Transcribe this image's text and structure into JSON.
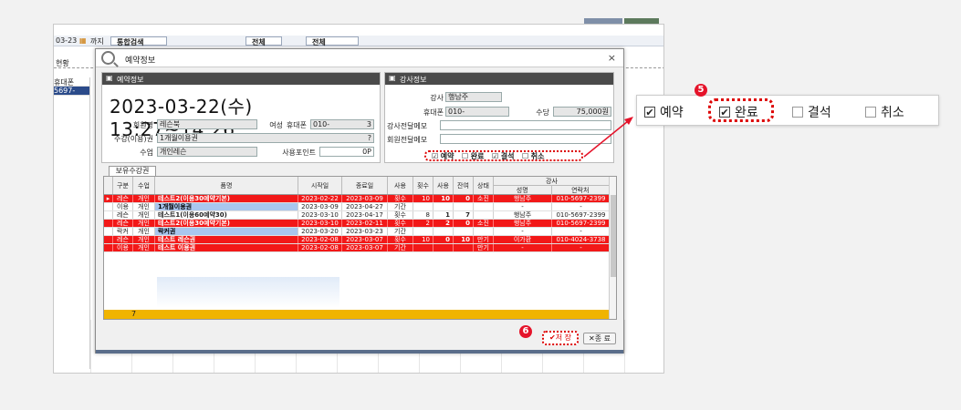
{
  "background": {
    "date": "03-23",
    "until": "까지",
    "search_type": "통합검색",
    "filter1": "전체",
    "filter2": "전체",
    "left_tab": "현황",
    "col_phone": "휴대폰",
    "phone_fragment": "5697-2399"
  },
  "dialog": {
    "title": "예약정보",
    "close": "×",
    "reservation_header": "예약정보",
    "date_time": "2023-03-22(수)  13:27~14:26",
    "member_name_label": "회원명",
    "member_name": "레슨북",
    "gender": "여성",
    "phone_label": "휴대폰",
    "phone_value": "010-",
    "phone_suffix": "3",
    "pass_label": "수강(이용)권",
    "pass_value": "1개월이용권",
    "class_label": "수업",
    "class_value": "개인레슨",
    "points_label": "사용포인트",
    "points_value": "0P",
    "q_icon": "?",
    "instructor_header": "강사정보",
    "instructor_number": "2",
    "instructor_label": "강사",
    "instructor_value": "행남주",
    "ins_phone_label": "휴대폰",
    "ins_phone_value": "010-",
    "fee_label": "수당",
    "fee_value": "75,000원",
    "ins_memo_label": "강사전달메모",
    "member_memo_label": "회원전달메모",
    "status_checks": [
      {
        "label": "예약",
        "checked": true
      },
      {
        "label": "완료",
        "checked": false
      },
      {
        "label": "결석",
        "checked": true
      },
      {
        "label": "취소",
        "checked": false
      }
    ],
    "tab_label": "보유수강권",
    "save_label": "✔저 장",
    "close_label": "✕종 료"
  },
  "table": {
    "headers": [
      "구분",
      "수업",
      "품명",
      "시작일",
      "종료일",
      "사용",
      "횟수",
      "사용",
      "잔여",
      "상태"
    ],
    "gangsa_header": "강사",
    "gangsa_sub": [
      "성명",
      "연락처"
    ],
    "rows": [
      {
        "c": [
          "레슨",
          "개인",
          "테스트2(이용30예약기본)",
          "2023-02-22",
          "2023-03-09",
          "횟수",
          "10",
          "10",
          "0",
          "소진",
          "행남주",
          "010-5697-2399"
        ],
        "style": "red",
        "marker": "▸"
      },
      {
        "c": [
          "이용",
          "개인",
          "1개월이용권",
          "2023-03-09",
          "2023-04-27",
          "기간",
          "",
          "",
          "",
          "",
          "-",
          "-"
        ],
        "style": "blue",
        "marker": ""
      },
      {
        "c": [
          "레슨",
          "개인",
          "테스트1(이용60예약30)",
          "2023-03-10",
          "2023-04-17",
          "횟수",
          "8",
          "1",
          "7",
          "",
          "행남주",
          "010-5697-2399"
        ],
        "style": "white",
        "marker": ""
      },
      {
        "c": [
          "레슨",
          "개인",
          "테스트2(이용30예약기본)",
          "2023-03-10",
          "2023-02-11",
          "횟수",
          "2",
          "2",
          "0",
          "소진",
          "행남주",
          "010-5697-2399"
        ],
        "style": "red",
        "marker": ""
      },
      {
        "c": [
          "락커",
          "개인",
          "락커권",
          "2023-03-20",
          "2023-03-23",
          "기간",
          "",
          "",
          "",
          "",
          "-",
          "-"
        ],
        "style": "blue",
        "marker": ""
      },
      {
        "c": [
          "레슨",
          "개인",
          "테스트 레슨권",
          "2023-02-08",
          "2023-03-07",
          "횟수",
          "10",
          "0",
          "10",
          "만기",
          "이가환",
          "010-4024-3738"
        ],
        "style": "red",
        "marker": ""
      },
      {
        "c": [
          "이용",
          "개인",
          "테스트 이용권",
          "2023-02-08",
          "2023-03-07",
          "기간",
          "",
          "",
          "",
          "만기",
          "-",
          "-"
        ],
        "style": "red",
        "marker": ""
      }
    ],
    "footer": "7"
  },
  "zoom": {
    "items": [
      {
        "label": "예약",
        "mark": "✔"
      },
      {
        "label": "완료",
        "mark": "✔"
      },
      {
        "label": "결석",
        "mark": ""
      },
      {
        "label": "취소",
        "mark": ""
      }
    ]
  },
  "badges": {
    "five": "5",
    "six": "6"
  },
  "colors": {
    "row_red": "#f21818",
    "row_blue": "#a9c6ee",
    "highlight": "#dd0000",
    "footer": "#f0b400"
  }
}
